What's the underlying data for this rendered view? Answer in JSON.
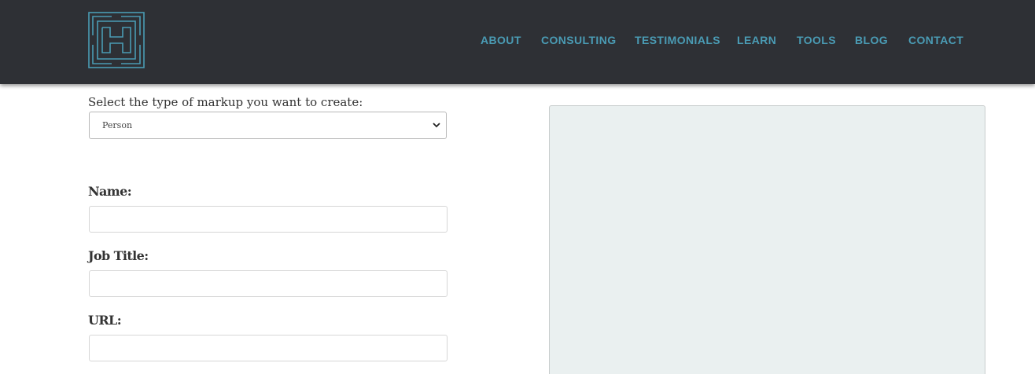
{
  "header": {
    "logo_icon": "h-maze-logo-icon",
    "background": "#2e3035",
    "accent": "#4a9bb4",
    "nav": [
      {
        "label": "ABOUT"
      },
      {
        "label": "CONSULTING"
      },
      {
        "label": "TESTIMONIALS"
      },
      {
        "label": "LEARN"
      },
      {
        "label": "TOOLS"
      },
      {
        "label": "BLOG"
      },
      {
        "label": "CONTACT"
      }
    ]
  },
  "form": {
    "markup_type_label": "Select the type of markup you want to create:",
    "markup_type_value": "Person",
    "fields": [
      {
        "label": "Name:",
        "value": "",
        "placeholder": ""
      },
      {
        "label": "Job Title:",
        "value": "",
        "placeholder": ""
      },
      {
        "label": "URL:",
        "value": "",
        "placeholder": ""
      }
    ]
  },
  "preview": {
    "background": "#eaf0f0",
    "content": ""
  }
}
